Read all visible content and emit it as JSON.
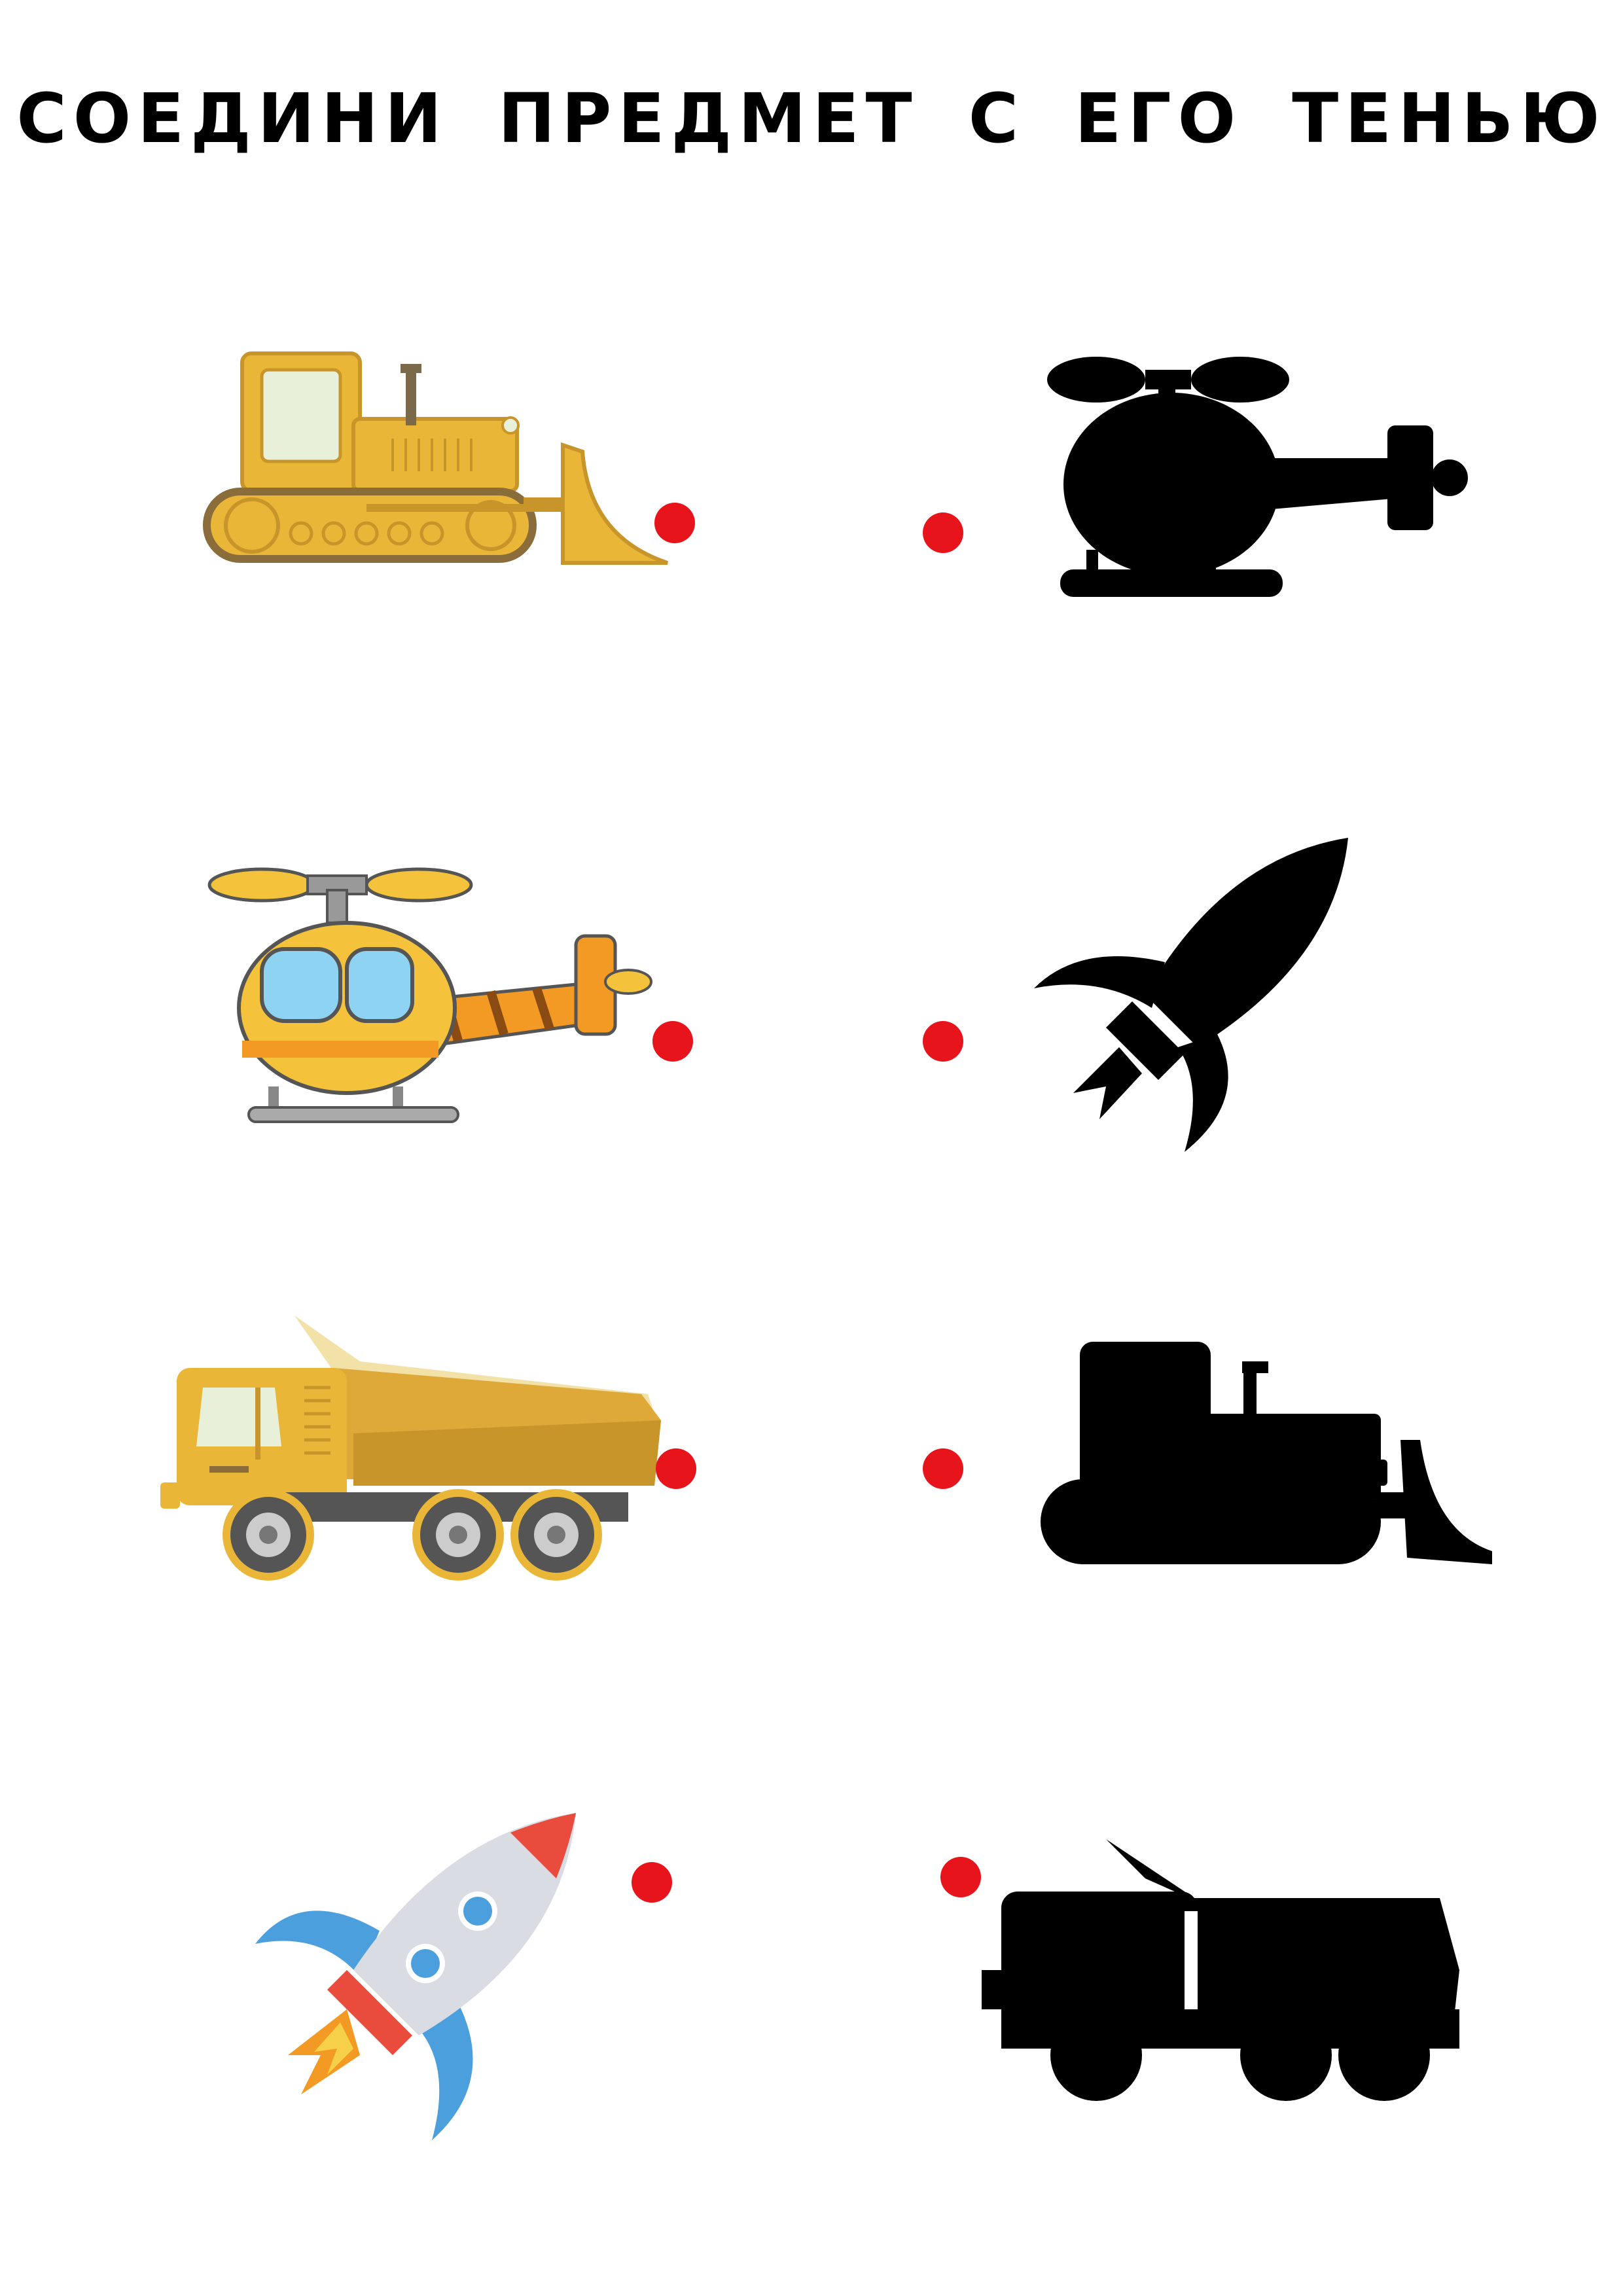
{
  "title": "СОЕДИНИ ПРЕДМЕТ С ЕГО ТЕНЬЮ",
  "colors": {
    "dot": "#e8141b",
    "shadow": "#000000",
    "yellow": "#eab638",
    "dark_yellow": "#c8952a",
    "orange": "#f39a25",
    "light_blue": "#8fd3f2",
    "rocket_body": "#d9dde3",
    "rocket_red": "#e94b3c",
    "rocket_blue": "#4b9fdc"
  },
  "left_items": [
    "bulldozer-image",
    "helicopter-image",
    "dump-truck-image",
    "rocket-image"
  ],
  "right_items": [
    "helicopter-shadow",
    "rocket-shadow",
    "bulldozer-shadow",
    "dump-truck-shadow"
  ]
}
